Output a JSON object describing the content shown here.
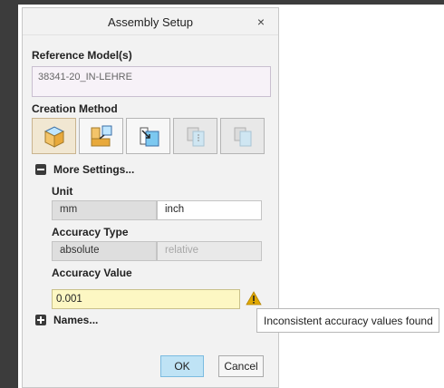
{
  "dialog": {
    "title": "Assembly Setup",
    "close_glyph": "×"
  },
  "reference": {
    "label": "Reference Model(s)",
    "value": "38341-20_IN-LEHRE"
  },
  "creation": {
    "label": "Creation Method",
    "buttons": [
      {
        "icon": "box-3d-icon",
        "state": "active"
      },
      {
        "icon": "l-shape-icon",
        "state": "normal"
      },
      {
        "icon": "split-blue-icon",
        "state": "normal"
      },
      {
        "icon": "layered-disabled-icon",
        "state": "disabled"
      },
      {
        "icon": "box-disabled-icon",
        "state": "disabled"
      }
    ]
  },
  "more_settings": {
    "label": "More Settings...",
    "unit": {
      "label": "Unit",
      "options": [
        "mm",
        "inch"
      ],
      "selected": "mm"
    },
    "accuracy_type": {
      "label": "Accuracy Type",
      "options": [
        "absolute",
        "relative"
      ],
      "selected": "absolute"
    },
    "accuracy_value": {
      "label": "Accuracy Value",
      "value": "0.001"
    }
  },
  "tooltip": {
    "text": "Inconsistent accuracy values found"
  },
  "names": {
    "label": "Names..."
  },
  "buttons": {
    "ok": "OK",
    "cancel": "Cancel"
  },
  "colors": {
    "warning": "#e0a800",
    "ok_bg": "#bfe3f5",
    "input_warn_bg": "#fdf7c3"
  }
}
